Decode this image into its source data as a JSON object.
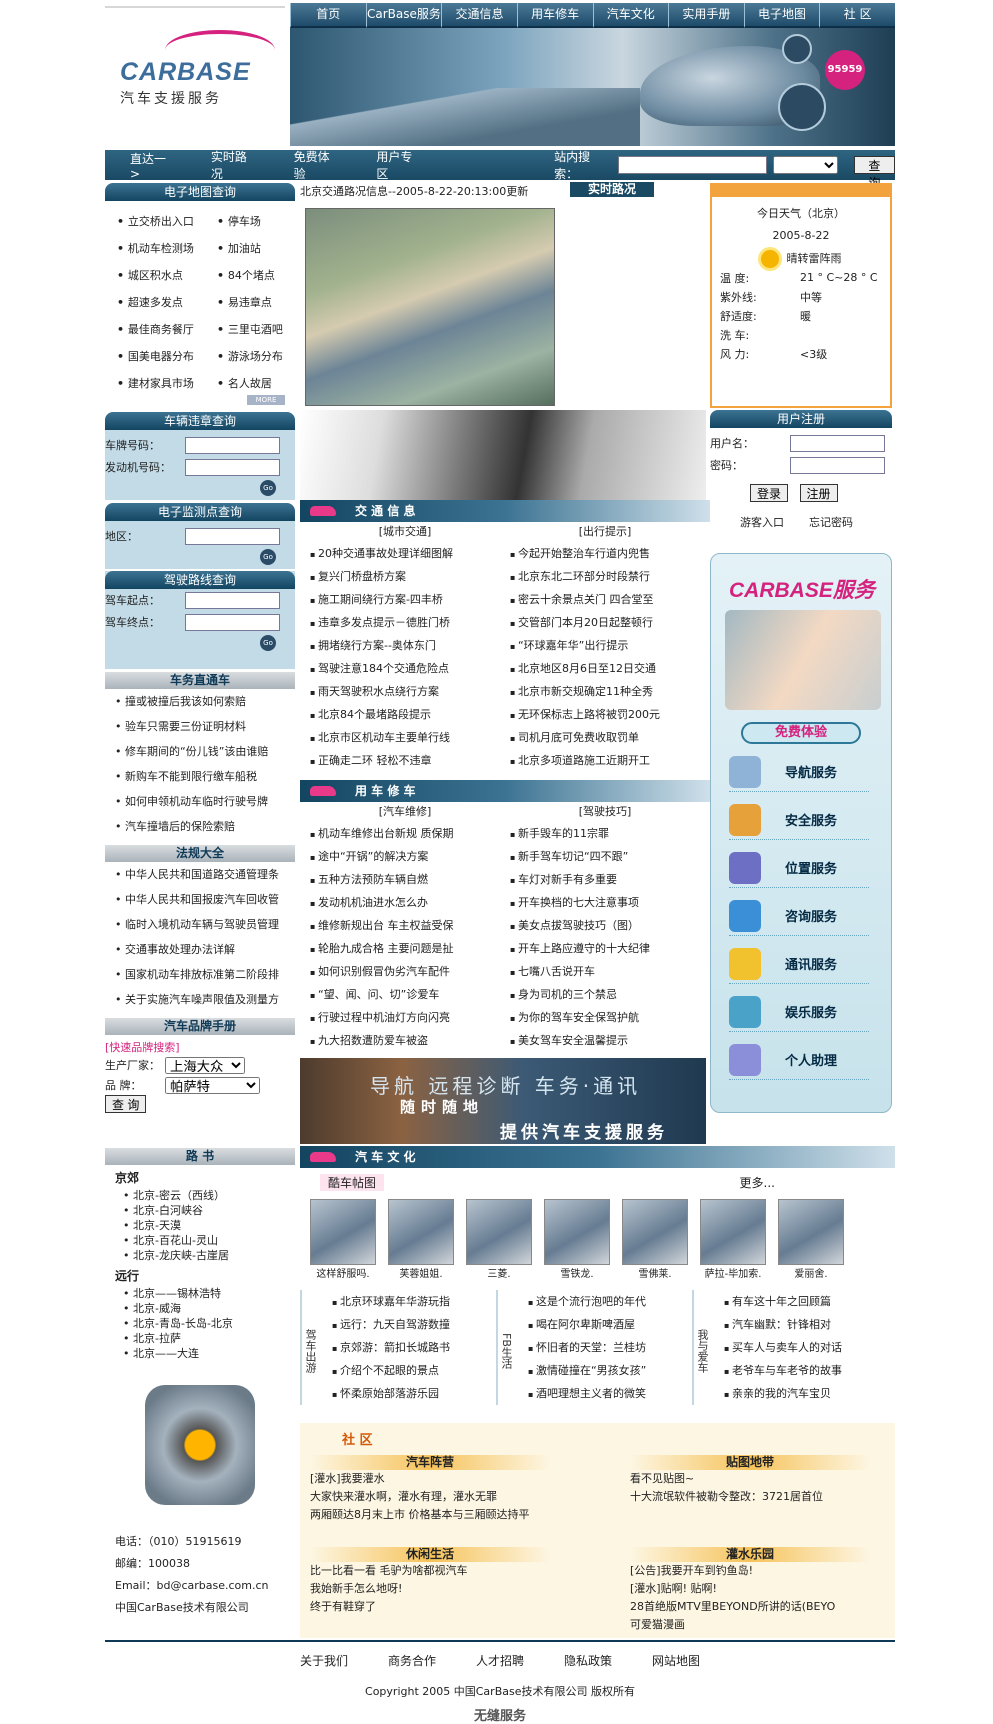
{
  "nav": [
    "首页",
    "CarBase服务",
    "交通信息",
    "用车修车",
    "汽车文化",
    "实用手册",
    "电子地图",
    "社 区"
  ],
  "logo": {
    "brand": "CARBASE",
    "sub": "汽车支援服务",
    "badge": "95959"
  },
  "subnav": {
    "items": [
      "直达一>",
      "实时路况",
      "免费体验",
      "用户专区"
    ],
    "search_label": "站内搜索：",
    "search_btn": "查 询"
  },
  "map": {
    "title": "电子地图查询",
    "items": [
      "立交桥出入口",
      "停车场",
      "机动车检测场",
      "加油站",
      "城区积水点",
      "84个堵点",
      "超速多发点",
      "易违章点",
      "最佳商务餐厅",
      "三里屯酒吧",
      "国美电器分布",
      "游泳场分布",
      "建材家具市场",
      "名人故居"
    ],
    "more": "MORE"
  },
  "traffic_head": "北京交通路况信息--2005-8-22-20:13:00更新",
  "realtime": "实时路况",
  "weather": {
    "title": "今日天气（北京）",
    "date": "2005-8-22",
    "desc": "晴转雷阵雨",
    "rows": [
      [
        "温  度:",
        "21 ° C~28 ° C"
      ],
      [
        "紫外线:",
        "中等"
      ],
      [
        "舒适度:",
        "暖"
      ],
      [
        "洗  车:",
        ""
      ],
      [
        "风  力:",
        "<3级"
      ]
    ]
  },
  "violation": {
    "title": "车辆违章查询",
    "plate": "车牌号码：",
    "engine": "发动机号码：",
    "go": "Go"
  },
  "monitor": {
    "title": "电子监测点查询",
    "area": "地区：",
    "go": "Go"
  },
  "route": {
    "title": "驾驶路线查询",
    "start": "驾车起点：",
    "end": "驾车终点：",
    "go": "Go"
  },
  "business": {
    "title": "车务直通车",
    "items": [
      "撞或被撞后我该如何索赔",
      "验车只需要三份证明材料",
      "修车期间的“份儿钱”该由谁赔",
      "新购车不能到限行缴车船税",
      "如何申领机动车临时行驶号牌",
      "汽车撞墙后的保险索赔"
    ]
  },
  "law": {
    "title": "法规大全",
    "items": [
      "中华人民共和国道路交通管理条",
      "中华人民共和国报废汽车回收管",
      "临时入境机动车辆与驾驶员管理",
      "交通事故处理办法详解",
      "国家机动车排放标准第二阶段排",
      "关于实施汽车噪声限值及测量方"
    ]
  },
  "brand": {
    "title": "汽车品牌手册",
    "quick": "[快速品牌搜索]",
    "maker_label": "生产厂家：",
    "maker": "上海大众",
    "brand_label": "品    牌：",
    "brand": "帕萨特",
    "btn": "查 询"
  },
  "roadbook": {
    "title": "路 书",
    "groups": [
      {
        "name": "京郊",
        "items": [
          "北京-密云（西线）",
          "北京-白河峡谷",
          "北京-天漠",
          "北京-百花山-灵山",
          "北京-龙庆峡-古崖居"
        ]
      },
      {
        "name": "远行",
        "items": [
          "北京——锡林浩特",
          "北京-威海",
          "北京-青岛-长岛-北京",
          "北京-拉萨",
          "北京——大连"
        ]
      }
    ]
  },
  "contact": {
    "phone": "电话：（010）51915619",
    "zip": "邮编：100038",
    "email": "Email：bd@carbase.com.cn",
    "company": "中国CarBase技术有限公司"
  },
  "user": {
    "title": "用户注册",
    "name": "用户名：",
    "pwd": "密码：",
    "login": "登录",
    "register": "注册",
    "guest": "游客入口",
    "forgot": "忘记密码"
  },
  "service": {
    "title": "CARBASE服务",
    "free": "免费体验",
    "items": [
      "导航服务",
      "安全服务",
      "位置服务",
      "咨询服务",
      "通讯服务",
      "娱乐服务",
      "个人助理"
    ]
  },
  "traffic": {
    "title": "交 通 信 息",
    "left_sub": "[城市交通]",
    "right_sub": "[出行提示]",
    "left": [
      "20种交通事故处理详细图解",
      "复兴门桥盘桥方案",
      "施工期间绕行方案-四丰桥",
      "违章多发点提示－德胜门桥",
      "拥堵绕行方案--奥体东门",
      "驾驶注意184个交通危险点",
      "雨天驾驶积水点绕行方案",
      "北京84个最堵路段提示",
      "北京市区机动车主要单行线",
      "正确走二环 轻松不违章"
    ],
    "right": [
      "今起开始整治车行道内兜售",
      "北京东北二环部分时段禁行",
      "密云十余景点关门 四合堂至",
      "交管部门本月20日起整顿行",
      "“环球嘉年华”出行提示",
      "北京地区8月6日至12日交通",
      "北京市新交规确定11种全秀",
      "无环保标志上路将被罚200元",
      "司机月底可免费收取罚单",
      "北京多项道路施工近期开工"
    ]
  },
  "repair": {
    "title": "用 车 修 车",
    "left_sub": "[汽车维修]",
    "right_sub": "[驾驶技巧]",
    "left": [
      "机动车维修出台新规 质保期",
      "途中“开锅”的解决方案",
      "五种方法预防车辆自燃",
      "发动机机油进水怎么办",
      "维修新规出台 车主权益受保",
      "轮胎九成合格 主要问题是扯",
      "如何识别假冒伪劣汽车配件",
      "“望、闻、问、切”诊爱车",
      "行驶过程中机油灯方向闪亮",
      "九大招数遭防爱车被盗"
    ],
    "right": [
      "新手毁车的11宗罪",
      "新手驾车切记“四不跟”",
      "车灯对新手有多重要",
      "开车换档的七大注意事项",
      "美女点拔驾驶技巧（图）",
      "开车上路应遵守的十大纪律",
      "七嘴八舌说开车",
      "身为司机的三个禁忌",
      "为你的驾车安全保驾护航",
      "美女驾车安全温馨提示"
    ]
  },
  "promo": {
    "a": "导航 远程诊断 车务·通讯",
    "b": "随时随地",
    "c": "提供汽车支援服务"
  },
  "culture": {
    "title": "汽 车 文 化",
    "tab": "酷车帖图",
    "more": "更多...",
    "thumbs": [
      "这样舒服吗.",
      "芙蓉姐姐.",
      "三菱.",
      "雪铁龙.",
      "雪佛莱.",
      "萨拉-毕加索.",
      "爱丽舍."
    ],
    "cols": [
      {
        "label": "驾车出游",
        "items": [
          "北京环球嘉年华游玩指",
          "远行：九天自驾游数撞",
          "京郊游：箭扣长城路书",
          "介绍个不起眼的景点",
          "怀柔原始部落游乐园"
        ]
      },
      {
        "label": "FB生活",
        "items": [
          "这是个流行泡吧的年代",
          "喝在阿尔卑斯啤酒屋",
          "怀旧者的天堂：兰桂坊",
          "激情碰撞在“男孩女孩”",
          "酒吧理想主义者的微笑"
        ]
      },
      {
        "label": "我与爱车",
        "items": [
          "有车这十年之回顾篇",
          "汽车幽默：针锋相对",
          "买车人与卖车人的对话",
          "老爷车与车老爷的故事",
          "亲亲的我的汽车宝贝"
        ]
      }
    ]
  },
  "community": {
    "title": "社 区",
    "boards": [
      {
        "title": "汽车阵营",
        "rows": [
          "[灌水]我要灌水",
          "大家快来灌水啊，灌水有理，灌水无罪",
          "两厢颐达8月末上市 价格基本与三厢颐达持平"
        ]
      },
      {
        "title": "贴图地带",
        "rows": [
          "看不见贴图~",
          "十大流氓软件被勒令整改：3721居首位"
        ]
      },
      {
        "title": "休闲生活",
        "rows": [
          "比一比看一看 毛驴为啥都视汽车",
          "我始新手怎么地呀!",
          "终于有鞋穿了"
        ]
      },
      {
        "title": "灌水乐园",
        "rows": [
          "[公告]我要开车到钓鱼岛!",
          "[灌水]贴啊! 贴啊!",
          "28首绝版MTV里BEYOND所讲的话(BEYO",
          "可爱猫漫画"
        ]
      }
    ]
  },
  "footer": {
    "links": [
      "关于我们",
      "商务合作",
      "人才招聘",
      "隐私政策",
      "网站地图"
    ],
    "copy": "Copyright 2005 中国CarBase技术有限公司 版权所有",
    "logo": "无缝服务"
  }
}
